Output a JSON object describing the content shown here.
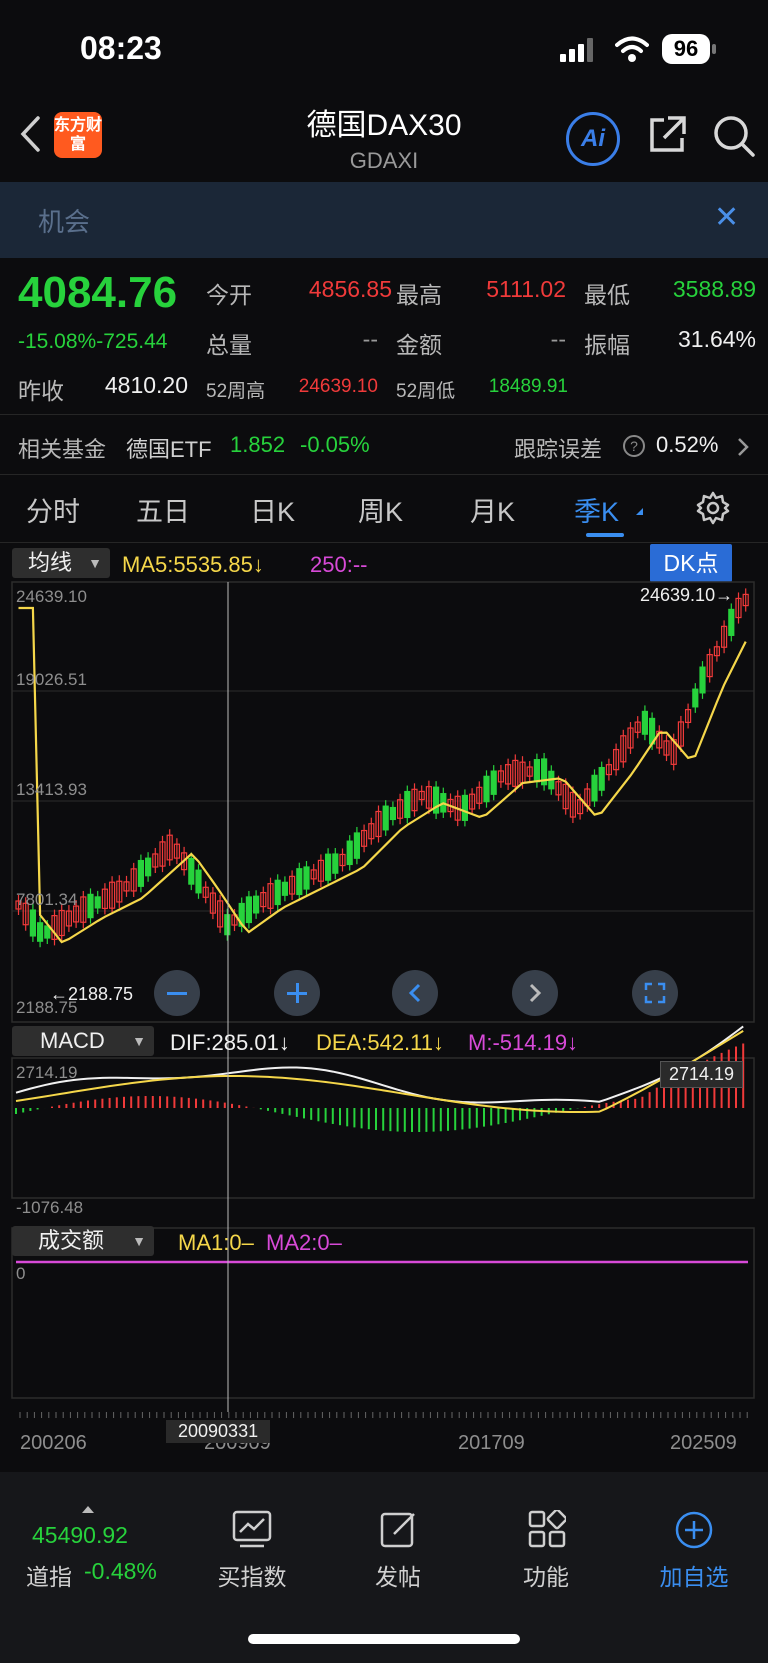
{
  "status": {
    "time": "08:23",
    "battery": "96"
  },
  "header": {
    "title": "德国DAX30",
    "subtitle": "GDAXI",
    "logo_text": "东方财富",
    "ai_label": "Ai"
  },
  "banner": {
    "text": "机会",
    "close": "✕"
  },
  "quote": {
    "price": "4084.76",
    "change": "-15.08%-725.44",
    "open_label": "今开",
    "open": "4856.85",
    "high_label": "最高",
    "high": "5111.02",
    "low_label": "最低",
    "low": "3588.89",
    "volume_label": "总量",
    "volume": "--",
    "amount_label": "金额",
    "amount": "--",
    "amplitude_label": "振幅",
    "amplitude": "31.64%",
    "prev_close_label": "昨收",
    "prev_close": "4810.20",
    "wk52_high_label": "52周高",
    "wk52_high": "24639.10",
    "wk52_low_label": "52周低",
    "wk52_low": "18489.91"
  },
  "fund": {
    "label": "相关基金",
    "name": "德国ETF",
    "price": "1.852",
    "change": "-0.05%",
    "tracking_label": "跟踪误差",
    "tracking_value": "0.52%"
  },
  "tabs": [
    "分时",
    "五日",
    "日K",
    "周K",
    "月K",
    "季K"
  ],
  "active_tab": "季K",
  "kline": {
    "selector": "均线",
    "ma5": "MA5:5535.85↓",
    "ma250": "250:--",
    "dk_button": "DK点",
    "y_labels": [
      "24639.10",
      "19026.51",
      "13413.93",
      "7801.34",
      "2188.75"
    ],
    "high_marker": "24639.10",
    "low_marker": "2188.75"
  },
  "macd": {
    "selector": "MACD",
    "dif": "DIF:285.01↓",
    "dea": "DEA:542.11↓",
    "m": "M:-514.19↓",
    "y_top": "2714.19",
    "y_bottom": "-1076.48",
    "max_marker": "2714.19"
  },
  "turnover": {
    "selector": "成交额",
    "ma1": "MA1:0–",
    "ma2": "MA2:0–",
    "y_zero": "0"
  },
  "x_axis": {
    "labels": [
      "200206",
      "200909",
      "201709",
      "202509"
    ],
    "crosshair_date": "20090331"
  },
  "bottom": {
    "index_price": "45490.92",
    "index_name": "道指",
    "index_change": "-0.48%",
    "buttons": [
      "买指数",
      "发帖",
      "功能",
      "加自选"
    ]
  }
}
